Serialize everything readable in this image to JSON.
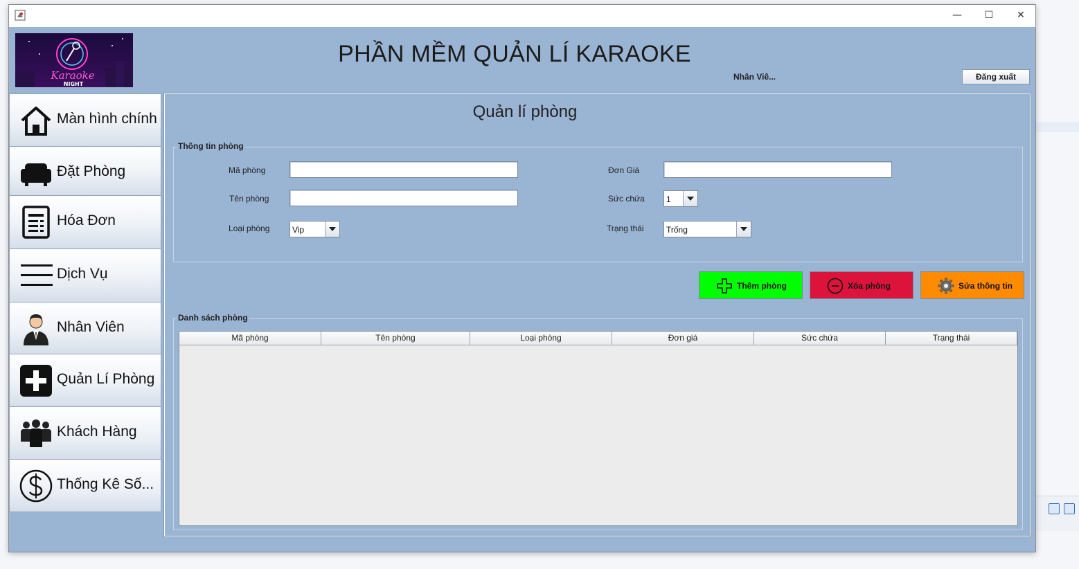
{
  "window": {
    "minimize": "—",
    "maximize": "☐",
    "close": "✕"
  },
  "logo": {
    "line1": "Karaoke",
    "line2": "NIGHT"
  },
  "header": {
    "title": "PHẦN MỀM QUẢN LÍ KARAOKE",
    "user": "Nhân Viê...",
    "logout": "Đăng xuất"
  },
  "sidebar": {
    "items": [
      {
        "label": "Màn hình chính",
        "icon": "home-icon"
      },
      {
        "label": "Đặt Phòng",
        "icon": "sofa-icon"
      },
      {
        "label": "Hóa Đơn",
        "icon": "invoice-icon"
      },
      {
        "label": "Dịch Vụ",
        "icon": "menu-lines-icon"
      },
      {
        "label": "Nhân Viên",
        "icon": "employee-icon"
      },
      {
        "label": "Quản Lí Phòng",
        "icon": "plus-square-icon"
      },
      {
        "label": "Khách Hàng",
        "icon": "people-icon"
      },
      {
        "label": "Thống Kê Số...",
        "icon": "dollar-circle-icon"
      }
    ]
  },
  "main": {
    "title": "Quản lí phòng",
    "info": {
      "legend": "Thông tin phòng",
      "ma_phong": {
        "label": "Mã phòng",
        "value": ""
      },
      "ten_phong": {
        "label": "Tên phòng",
        "value": ""
      },
      "loai_phong": {
        "label": "Loại phòng",
        "value": "Vip"
      },
      "don_gia": {
        "label": "Đơn Giá",
        "value": ""
      },
      "suc_chua": {
        "label": "Sức chứa",
        "value": "1"
      },
      "trang_thai": {
        "label": "Trạng thái",
        "value": "Trống"
      }
    },
    "actions": {
      "add": "Thêm phòng",
      "delete": "Xóa phòng",
      "edit": "Sửa thông tin",
      "colors": {
        "add": "#00ff00",
        "delete": "#dc143c",
        "edit": "#ff8c00"
      }
    },
    "list": {
      "legend": "Danh sách phòng",
      "columns": [
        "Mã phòng",
        "Tên phòng",
        "Loại phòng",
        "Đơn giá",
        "Sức chứa",
        "Trạng thái"
      ],
      "rows": []
    }
  }
}
